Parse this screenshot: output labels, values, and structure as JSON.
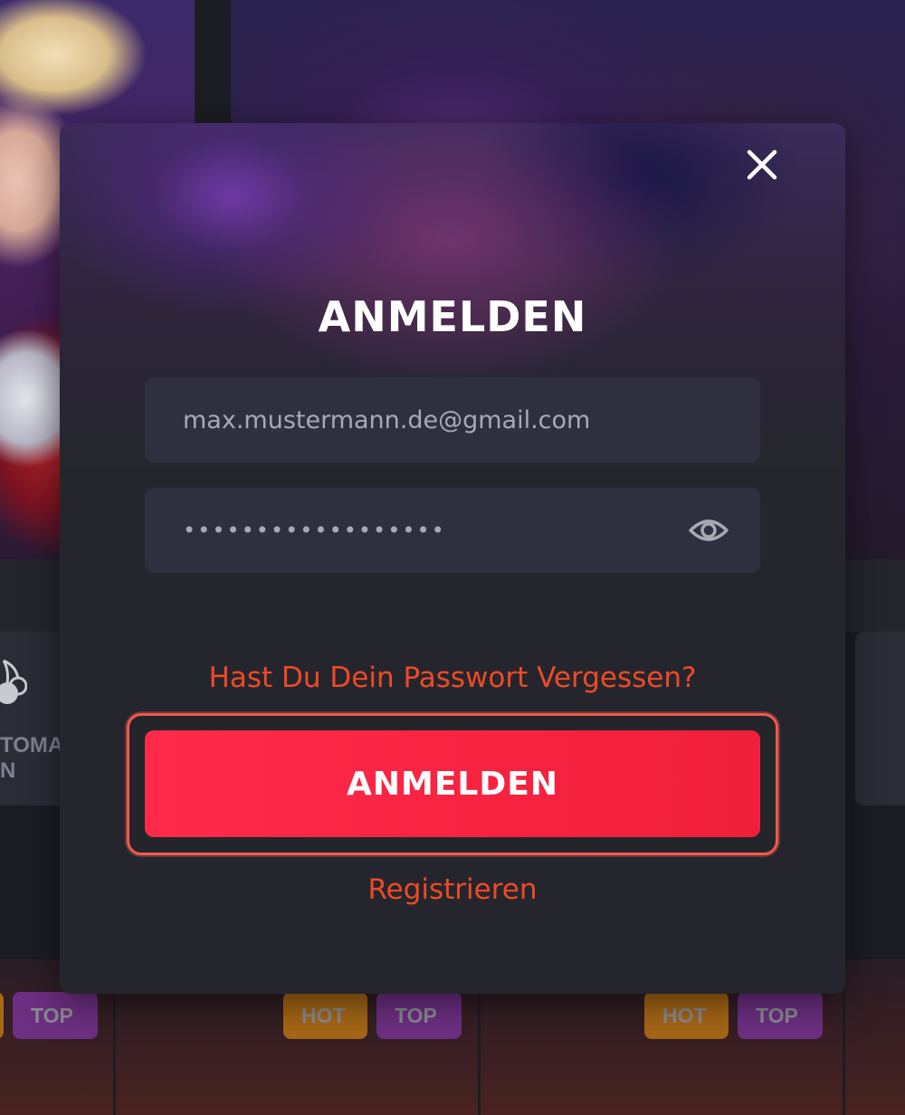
{
  "colors": {
    "accent_red": "#f72240",
    "link_orange": "#ee4a25",
    "modal_bg": "#25262d",
    "field_bg": "#2e3040",
    "badge_hot": "#a66716",
    "badge_top": "#6d2f82"
  },
  "background": {
    "left_card_icon": "cherry-icon",
    "left_card_caption_line1": "TOMA",
    "left_card_caption_line2": "N",
    "badges": [
      {
        "label": "TOP"
      },
      {
        "label": "HOT"
      },
      {
        "label": "TOP"
      },
      {
        "label": "HOT"
      },
      {
        "label": "TOP"
      }
    ]
  },
  "modal": {
    "close_icon": "close-icon",
    "title": "ANMELDEN",
    "email": {
      "value": "max.mustermann.de@gmail.com"
    },
    "password": {
      "value": "••••••••••••••••••",
      "toggle_icon": "eye-icon"
    },
    "forgot_link": "Hast Du Dein Passwort Vergessen?",
    "submit_label": "ANMELDEN",
    "register_link": "Registrieren"
  }
}
